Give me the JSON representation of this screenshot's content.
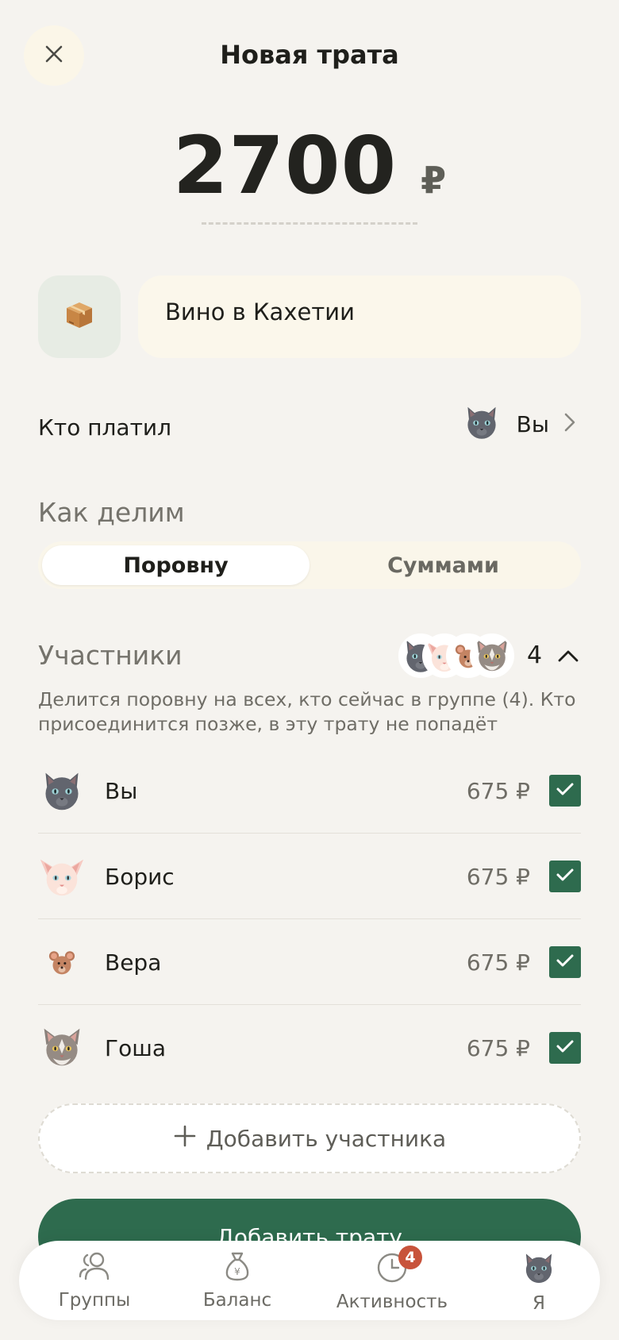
{
  "header": {
    "title": "Новая трата"
  },
  "amount": {
    "value": "2700",
    "currency": "₽"
  },
  "expense": {
    "category_icon": "package-icon",
    "name": "Вино в Кахетии"
  },
  "payer": {
    "label": "Кто платил",
    "name": "Вы",
    "avatar": "gray-cat"
  },
  "split": {
    "label": "Как делим",
    "options": [
      "Поровну",
      "Суммами"
    ],
    "selected": "Поровну"
  },
  "participants": {
    "label": "Участники",
    "count": "4",
    "description": "Делится поровну на всех, кто сейчас в группе (4). Кто присоединится позже, в эту трату не попадёт",
    "rows": [
      {
        "name": "Вы",
        "amount": "675 ₽",
        "checked": true,
        "avatar": "gray-cat"
      },
      {
        "name": "Борис",
        "amount": "675 ₽",
        "checked": true,
        "avatar": "sphynx-cat"
      },
      {
        "name": "Вера",
        "amount": "675 ₽",
        "checked": true,
        "avatar": "mouse"
      },
      {
        "name": "Гоша",
        "amount": "675 ₽",
        "checked": true,
        "avatar": "tabby-cat"
      }
    ],
    "add_label": "Добавить участника"
  },
  "primary_action": {
    "label": "Добавить трату"
  },
  "tabbar": {
    "items": [
      {
        "label": "Группы",
        "icon": "people-icon"
      },
      {
        "label": "Баланс",
        "icon": "money-bag-icon"
      },
      {
        "label": "Активность",
        "icon": "clock-icon",
        "badge": "4"
      },
      {
        "label": "Я",
        "icon": "avatar"
      }
    ]
  },
  "colors": {
    "background": "#f5f3ef",
    "accent": "#2e6b4e",
    "badge": "#c8533b"
  }
}
